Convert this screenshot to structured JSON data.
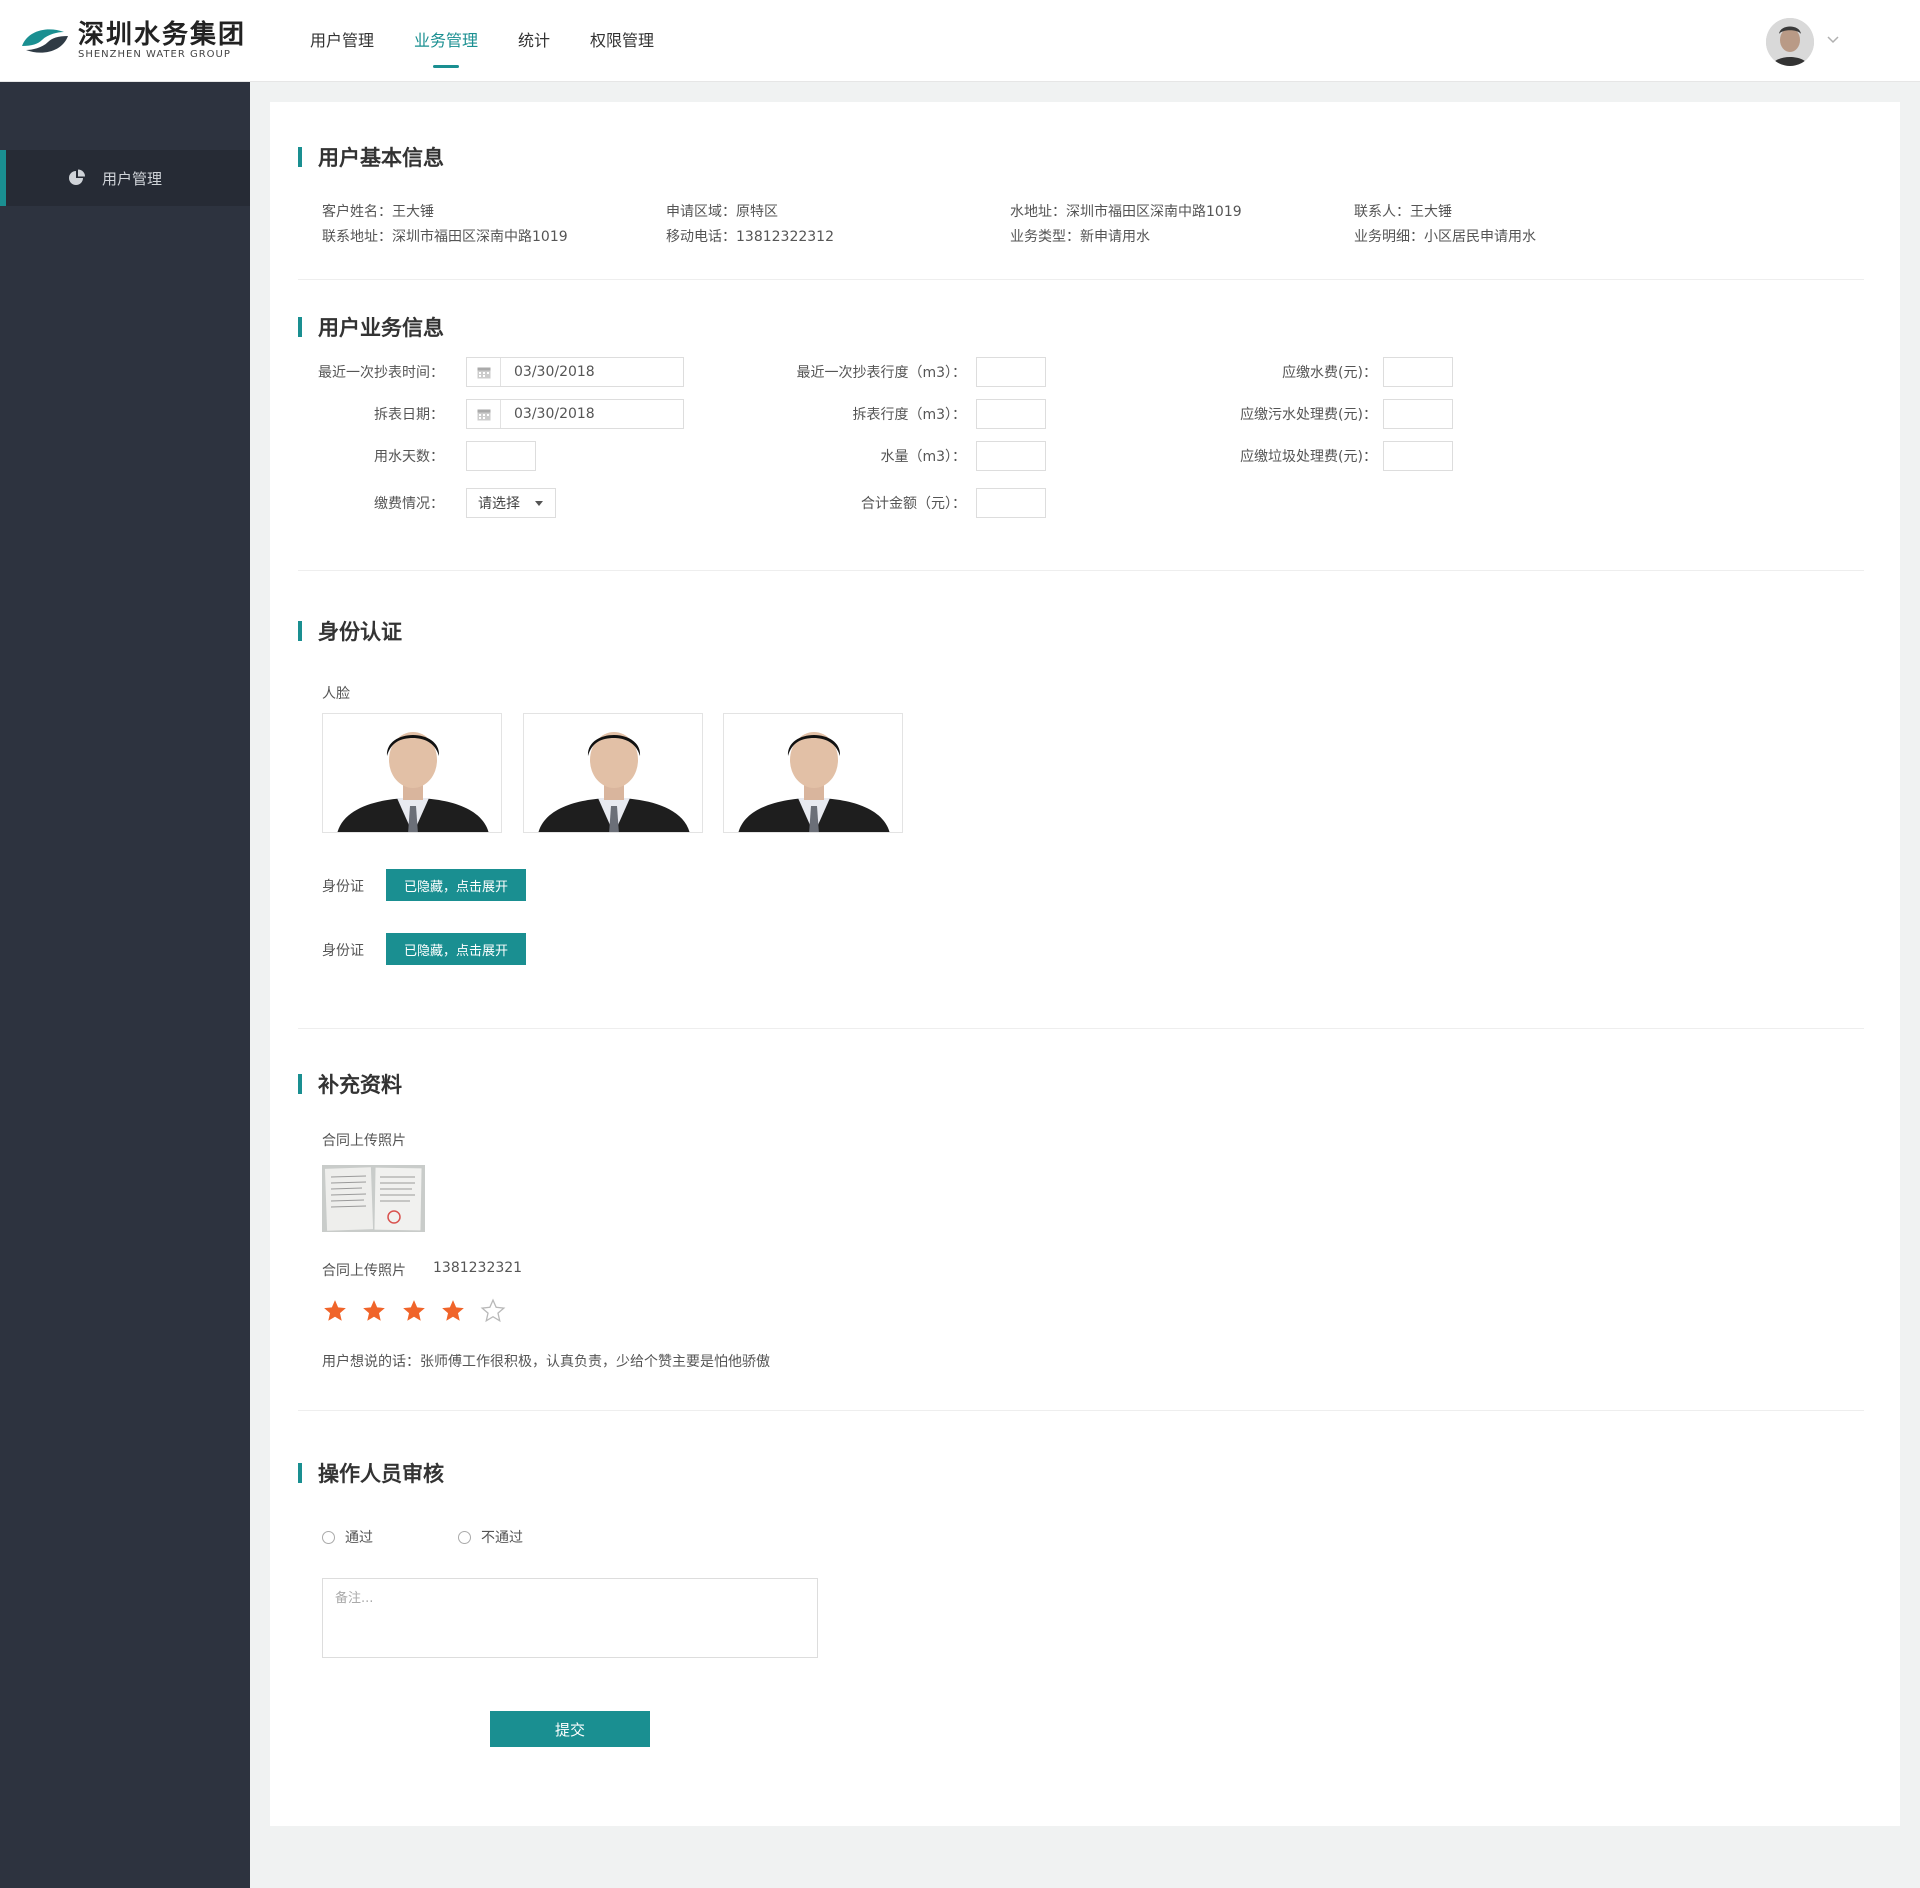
{
  "brand": {
    "name_cn": "深圳水务集团",
    "name_en": "SHENZHEN WATER GROUP",
    "accent": "#1a8f91"
  },
  "nav": {
    "items": [
      {
        "label": "用户管理"
      },
      {
        "label": "业务管理",
        "active": true
      },
      {
        "label": "统计"
      },
      {
        "label": "权限管理"
      }
    ]
  },
  "sidebar": {
    "items": [
      {
        "label": "用户管理",
        "icon": "pie-chart-icon"
      }
    ]
  },
  "basic_info": {
    "title": "用户基本信息",
    "customer_name": "客户姓名：王大锤",
    "region": "申请区域：原特区",
    "water_address": "水地址：深圳市福田区深南中路1019",
    "contact": "联系人：王大锤",
    "contact_address": "联系地址：深圳市福田区深南中路1019",
    "mobile": "移动电话：13812322312",
    "business_type": "业务类型：新申请用水",
    "business_detail": "业务明细：小区居民申请用水"
  },
  "business_info": {
    "title": "用户业务信息",
    "last_read_time_label": "最近一次抄表时间：",
    "last_read_time_value": "03/30/2018",
    "remove_date_label": "拆表日期：",
    "remove_date_value": "03/30/2018",
    "days_label": "用水天数：",
    "payment_label": "缴费情况：",
    "payment_select": "请选择",
    "last_reading_label": "最近一次抄表行度（m3）：",
    "remove_reading_label": "拆表行度（m3）：",
    "volume_label": "水量（m3）：",
    "total_label": "合计金额（元）：",
    "water_fee_label": "应缴水费(元)：",
    "sewage_fee_label": "应缴污水处理费(元)：",
    "garbage_fee_label": "应缴垃圾处理费(元)："
  },
  "identity": {
    "title": "身份认证",
    "face_label": "人脸",
    "id_label_1": "身份证",
    "id_button_1": "已隐藏，点击展开",
    "id_label_2": "身份证",
    "id_button_2": "已隐藏，点击展开"
  },
  "supplement": {
    "title": "补充资料",
    "contract_label": "合同上传照片",
    "contract_label_2": "合同上传照片",
    "contract_number": "1381232321",
    "rating": 4,
    "rating_max": 5,
    "star_color": "#f0642a",
    "user_comment": "用户想说的话：张师傅工作很积极，认真负责，少给个赞主要是怕他骄傲"
  },
  "review": {
    "title": "操作人员审核",
    "pass_label": "通过",
    "fail_label": "不通过",
    "remark_placeholder": "备注...",
    "submit_label": "提交"
  }
}
